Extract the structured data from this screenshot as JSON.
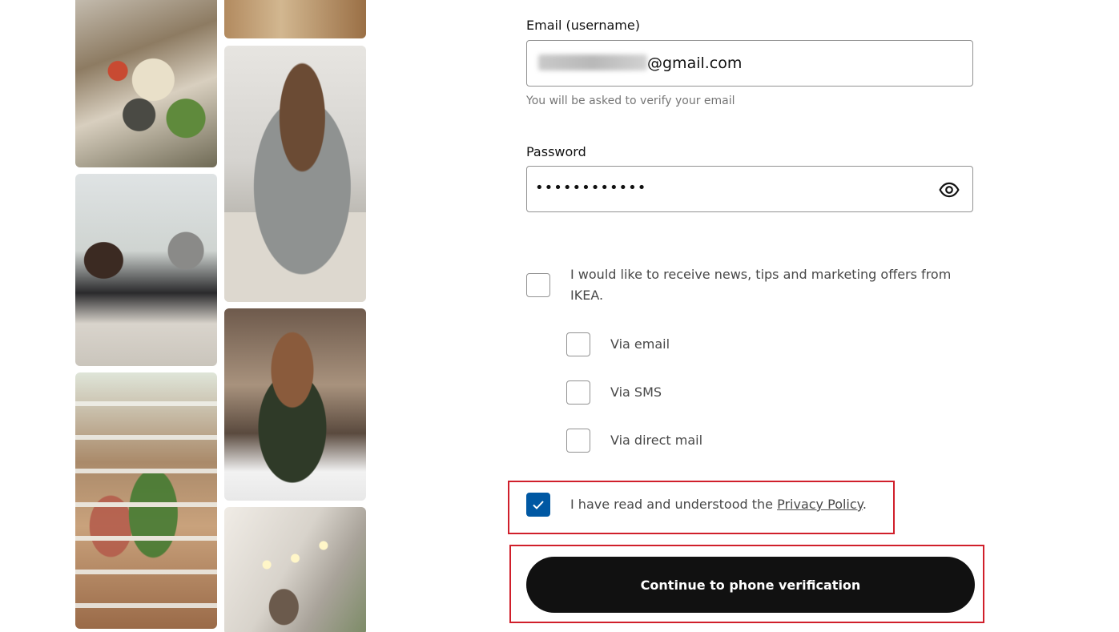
{
  "collage": {
    "photos": [
      "family-meal-photo",
      "wood-samples-photo",
      "man-with-phone-photo",
      "couple-on-sofa-photo",
      "woman-laughing-photo",
      "plant-shop-photo",
      "string-lights-room-photo"
    ]
  },
  "form": {
    "email": {
      "label": "Email (username)",
      "value_visible": "@gmail.com",
      "hint": "You will be asked to verify your email"
    },
    "password": {
      "label": "Password",
      "masked_value": "••••••••••••",
      "toggle_icon": "eye-icon"
    },
    "marketing": {
      "label": "I would like to receive news, tips and marketing offers from IKEA.",
      "checked": false,
      "options": [
        {
          "label": "Via email",
          "checked": false
        },
        {
          "label": "Via SMS",
          "checked": false
        },
        {
          "label": "Via direct mail",
          "checked": false
        }
      ]
    },
    "privacy": {
      "prefix": "I have read and understood the ",
      "link_text": "Privacy Policy",
      "suffix": ".",
      "checked": true
    },
    "continue_label": "Continue to phone verification"
  },
  "colors": {
    "accent_blue": "#0058a3",
    "button_bg": "#111111",
    "highlight_red": "#d01f2b"
  }
}
